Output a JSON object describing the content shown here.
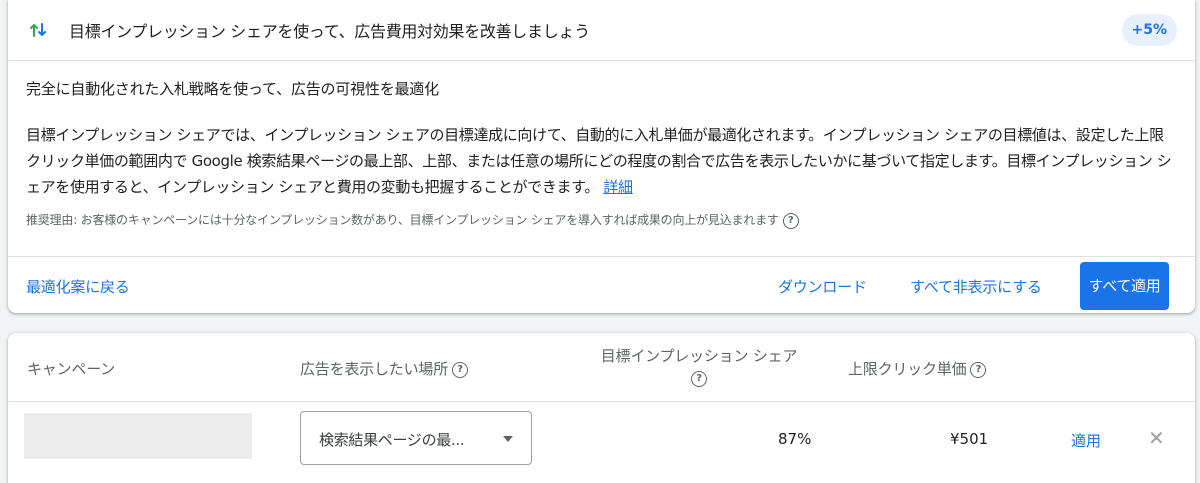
{
  "header": {
    "icon": "trending-arrows-icon",
    "title": "目標インプレッション シェアを使って、広告費用対効果を改善しましょう",
    "uplift_badge": "+5%"
  },
  "body": {
    "subtitle": "完全に自動化された入札戦略を使って、広告の可視性を最適化",
    "description": "目標インプレッション シェアでは、インプレッション シェアの目標達成に向けて、自動的に入札単価が最適化されます。インプレッション シェアの目標値は、設定した上限クリック単価の範囲内で Google 検索結果ページの最上部、上部、または任意の場所にどの程度の割合で広告を表示したいかに基づいて指定します。目標インプレッション シェアを使用すると、インプレッション シェアと費用の変動も把握することができます。",
    "learn_more": "詳細",
    "reason": "推奨理由: お客様のキャンペーンには十分なインプレッション数があり、目標インプレッション シェアを導入すれば成果の向上が見込まれます"
  },
  "footer": {
    "back_link": "最適化案に戻る",
    "download": "ダウンロード",
    "dismiss_all": "すべて非表示にする",
    "apply_all": "すべて適用"
  },
  "table": {
    "headers": {
      "campaign": "キャンペーン",
      "placement": "広告を表示したい場所",
      "target_share": "目標インプレッション シェア",
      "max_cpc": "上限クリック単価"
    },
    "rows": [
      {
        "placement": "検索結果ページの最...",
        "target_share": "87%",
        "max_cpc": "¥501",
        "apply": "適用"
      }
    ]
  },
  "colors": {
    "accent": "#1a73e8",
    "trend_up": "#34a853",
    "trend_down": "#1e8e3e"
  }
}
